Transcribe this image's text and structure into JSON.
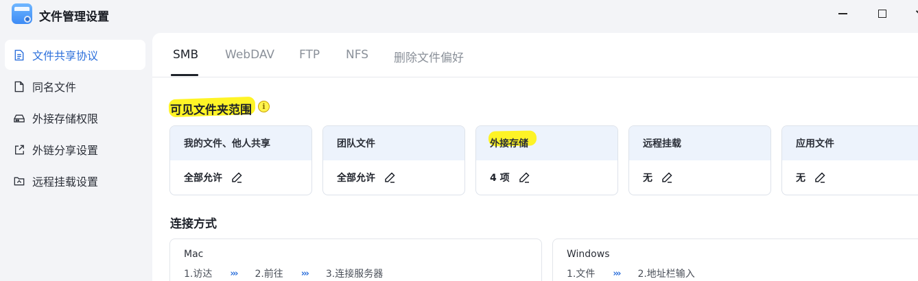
{
  "app": {
    "title": "文件管理设置"
  },
  "sidebar": {
    "items": [
      {
        "label": "文件共享协议",
        "icon": "document-icon",
        "active": true
      },
      {
        "label": "同名文件",
        "icon": "file-icon",
        "active": false
      },
      {
        "label": "外接存储权限",
        "icon": "drive-icon",
        "active": false
      },
      {
        "label": "外链分享设置",
        "icon": "share-icon",
        "active": false
      },
      {
        "label": "远程挂载设置",
        "icon": "remote-mount-icon",
        "active": false
      }
    ]
  },
  "tabs": [
    {
      "label": "SMB",
      "active": true
    },
    {
      "label": "WebDAV",
      "active": false
    },
    {
      "label": "FTP",
      "active": false
    },
    {
      "label": "NFS",
      "active": false
    },
    {
      "label": "删除文件偏好",
      "active": false
    }
  ],
  "visible_scope": {
    "title": "可见文件夹范围",
    "cards": [
      {
        "header": "我的文件、他人共享",
        "value": "全部允许"
      },
      {
        "header": "团队文件",
        "value": "全部允许"
      },
      {
        "header": "外接存储",
        "value": "4 项"
      },
      {
        "header": "远程挂载",
        "value": "无"
      },
      {
        "header": "应用文件",
        "value": "无"
      }
    ]
  },
  "connection": {
    "title": "连接方式",
    "mac": {
      "title": "Mac",
      "steps": [
        "1.访达",
        "2.前往",
        "3.连接服务器"
      ]
    },
    "windows": {
      "title": "Windows",
      "steps": [
        "1.文件",
        "2.地址栏输入"
      ]
    },
    "arrow": "›››"
  },
  "colors": {
    "accent": "#2b6fdb",
    "highlight": "#fff200",
    "card_header_bg": "#edf3fc"
  }
}
